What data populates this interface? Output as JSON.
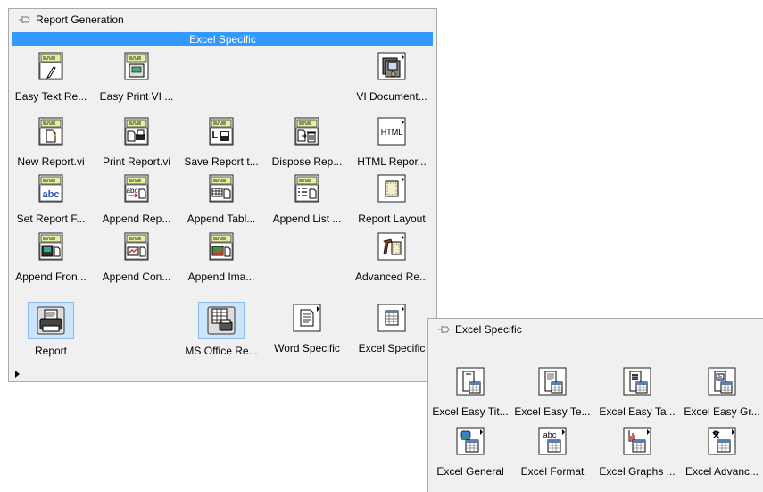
{
  "main_palette": {
    "title": "Report Generation",
    "header": "Excel Specific",
    "items": [
      {
        "label": "Easy Text Re...",
        "icon": "easy-text-report-icon"
      },
      {
        "label": "Easy Print VI ...",
        "icon": "easy-print-vi-icon"
      },
      {
        "label": "VI Document...",
        "icon": "vi-documentation-icon"
      },
      {
        "label": "New Report.vi",
        "icon": "new-report-icon"
      },
      {
        "label": "Print Report.vi",
        "icon": "print-report-icon"
      },
      {
        "label": "Save Report t...",
        "icon": "save-report-icon"
      },
      {
        "label": "Dispose Rep...",
        "icon": "dispose-report-icon"
      },
      {
        "label": "HTML Repor...",
        "icon": "html-report-icon",
        "icon_text": "HTML"
      },
      {
        "label": "Set Report F...",
        "icon": "set-report-font-icon",
        "icon_text": "abc"
      },
      {
        "label": "Append Rep...",
        "icon": "append-report-text-icon",
        "icon_text": "abc"
      },
      {
        "label": "Append Tabl...",
        "icon": "append-table-icon"
      },
      {
        "label": "Append List ...",
        "icon": "append-list-icon"
      },
      {
        "label": "Report Layout",
        "icon": "report-layout-icon"
      },
      {
        "label": "Append Fron...",
        "icon": "append-front-panel-icon"
      },
      {
        "label": "Append Con...",
        "icon": "append-control-image-icon"
      },
      {
        "label": "Append Ima...",
        "icon": "append-image-icon"
      },
      {
        "label": "Advanced Re...",
        "icon": "advanced-report-icon"
      },
      {
        "label": "Report",
        "icon": "report-printer-icon"
      },
      {
        "label": "MS Office Re...",
        "icon": "ms-office-report-icon"
      },
      {
        "label": "Word Specific",
        "icon": "word-specific-icon"
      },
      {
        "label": "Excel Specific",
        "icon": "excel-specific-icon"
      }
    ]
  },
  "excel_palette": {
    "title": "Excel Specific",
    "items": [
      {
        "label": "Excel Easy Tit...",
        "icon": "excel-easy-title-icon"
      },
      {
        "label": "Excel Easy Te...",
        "icon": "excel-easy-text-icon"
      },
      {
        "label": "Excel Easy Ta...",
        "icon": "excel-easy-table-icon"
      },
      {
        "label": "Excel Easy Gr...",
        "icon": "excel-easy-graph-icon"
      },
      {
        "label": "Excel General",
        "icon": "excel-general-icon"
      },
      {
        "label": "Excel Format",
        "icon": "excel-format-icon",
        "icon_text": "abc"
      },
      {
        "label": "Excel Graphs ...",
        "icon": "excel-graphs-icon"
      },
      {
        "label": "Excel Advanc...",
        "icon": "excel-advanced-icon"
      }
    ]
  },
  "colors": {
    "selection": "#3399ff",
    "selected_tile": "#cce4fc",
    "palette_bg": "#f0f0f0"
  }
}
